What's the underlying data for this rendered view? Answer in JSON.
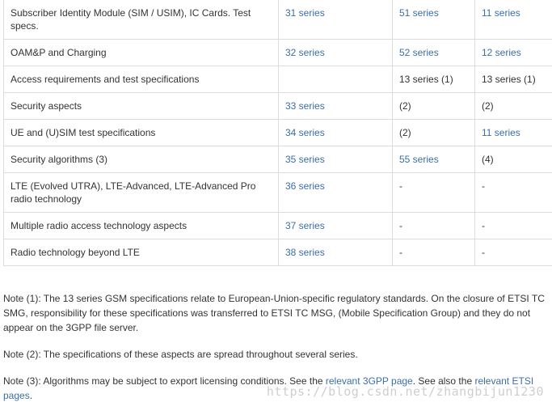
{
  "table": {
    "rows": [
      [
        "Subscriber Identity Module (SIM / USIM), IC Cards. Test specs.",
        "31 series",
        "51 series",
        "11 series"
      ],
      [
        "OAM&P and Charging",
        "32 series",
        "52 series",
        "12 series"
      ],
      [
        "Access requirements and test specifications",
        "",
        "13 series (1)",
        "13 series (1)"
      ],
      [
        "Security aspects",
        "33 series",
        "(2)",
        "(2)"
      ],
      [
        "UE and (U)SIM test specifications",
        "34 series",
        "(2)",
        "11 series"
      ],
      [
        "Security algorithms (3)",
        "35 series",
        "55 series",
        "(4)"
      ],
      [
        "LTE (Evolved UTRA), LTE-Advanced, LTE-Advanced Pro radio technology",
        "36 series",
        "-",
        "-"
      ],
      [
        "Multiple radio access technology aspects",
        "37 series",
        "-",
        "-"
      ],
      [
        "Radio technology beyond LTE",
        "38 series",
        "-",
        "-"
      ]
    ]
  },
  "notes": {
    "note1": "Note (1): The 13 series GSM specifications relate to European-Union-specific regulatory standards. On the closure of ETSI TC SMG, responsibility for these specifications was transferred to ETSI TC MSG, (Mobile Specification Group) and they do not appear on the 3GPP file server.",
    "note2": "Note (2): The specifications of these aspects are spread throughout several series.",
    "note3_prefix": "Note (3): Algorithms may be subject to export licensing conditions. See the ",
    "note3_link1": "relevant 3GPP page",
    "note3_mid": ". See also the ",
    "note3_link2": "relevant ETSI pages",
    "note3_suffix": "."
  },
  "watermark": "https://blog.csdn.net/zhangbijun1230",
  "colors": {
    "link": "#3a6ea8",
    "text": "#333333",
    "border": "#dcdcdc"
  }
}
